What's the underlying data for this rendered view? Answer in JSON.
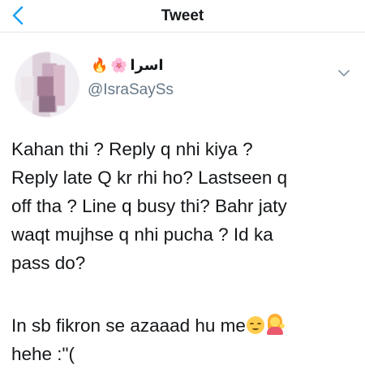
{
  "nav": {
    "title": "Tweet",
    "back_icon": "chevron-left-icon"
  },
  "author": {
    "display_name": "اسرا",
    "name_emojis": [
      "fire-emoji",
      "blossom-emoji"
    ],
    "handle": "@IsraSaySs",
    "avatar_icon": "blurred-avatar"
  },
  "tweet": {
    "text": "Kahan thi ? Reply q nhi kiya ?\nReply late Q kr rhi ho? Lastseen q\noff tha ? Line q busy thi? Bahr jaty\nwaqt mujhse q nhi pucha ? Id ka\npass do?",
    "line2_text": "In sb fikron se azaaad hu me",
    "line2_emojis": [
      "relieved-face-emoji",
      "tipping-hand-person-emoji"
    ],
    "line3_text": "hehe :\"("
  },
  "colors": {
    "accent": "#1da1f2",
    "text": "#14171a",
    "secondary": "#657786",
    "divider": "#e1e8ed"
  }
}
